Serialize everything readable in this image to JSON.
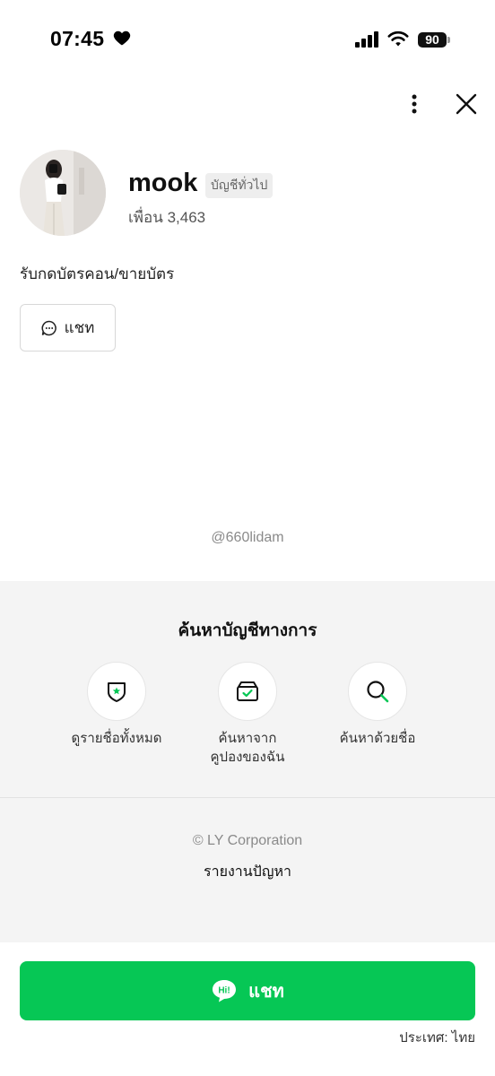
{
  "status_bar": {
    "time": "07:45",
    "battery": "90"
  },
  "profile": {
    "name": "mook",
    "account_type": "บัญชีทั่วไป",
    "friends": "เพื่อน 3,463",
    "status_message": "รับกดบัตรคอน/ขายบัตร",
    "chat_button": "แชท",
    "line_id": "@660lidam"
  },
  "official_search": {
    "title": "ค้นหาบัญชีทางการ",
    "items": [
      {
        "label": "ดูรายชื่อทั้งหมด",
        "icon": "shield-star-icon"
      },
      {
        "label": "ค้นหาจาก\nคูปองของฉัน",
        "icon": "coupon-box-icon"
      },
      {
        "label": "ค้นหาด้วยชื่อ",
        "icon": "search-icon"
      }
    ]
  },
  "footer": {
    "copyright": "© LY Corporation",
    "report": "รายงานปัญหา",
    "chat_button": "แชท",
    "hi_icon_text": "Hi!",
    "country": "ประเทศ: ไทย"
  },
  "colors": {
    "accent": "#06c755",
    "section_bg": "#f4f4f4"
  }
}
